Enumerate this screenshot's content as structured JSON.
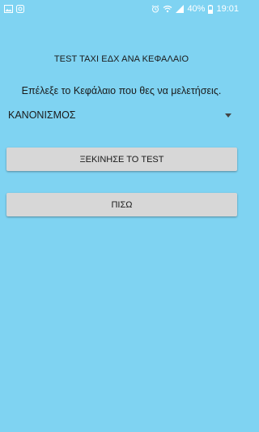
{
  "status_bar": {
    "battery": "40%",
    "time": "19:01",
    "icons_left": [
      "image-icon",
      "app-notification-icon"
    ],
    "icons_right": [
      "alarm-icon",
      "wifi-icon",
      "signal-icon",
      "battery-icon"
    ]
  },
  "screen": {
    "title": "TEST TAXI ΕΔΧ ΑΝΑ ΚΕΦΑΛΑΙΟ",
    "prompt": "Επέλεξε το Κεφάλαιο που θες να μελετήσεις.",
    "spinner": {
      "selected": "ΚΑΝΟΝΙΣΜΟΣ"
    },
    "start_button": "ΞΕΚΙΝΗΣΕ ΤΟ TEST",
    "back_button": "ΠΙΣΩ"
  },
  "colors": {
    "background": "#7fd3f2",
    "button": "#d7d7d7"
  }
}
